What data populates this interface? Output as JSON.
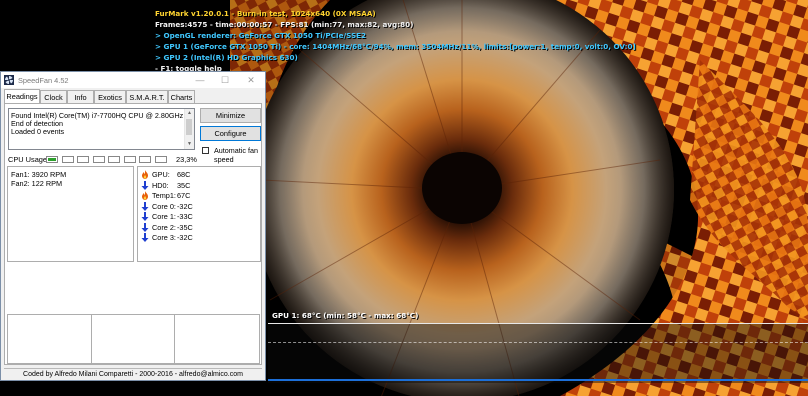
{
  "furmark": {
    "osd": {
      "line1": "FurMark v1.20.0.1 - Burn-in test, 1024x640 (0X MSAA)",
      "line2": "Frames:4575 - time:00:00:57 - FPS:81 (min:77, max:82, avg:80)",
      "line3": "> OpenGL renderer: GeForce GTX 1050 Ti/PCIe/SSE2",
      "line4": "> GPU 1 (GeForce GTX 1050 Ti) - core: 1404MHz/68°C/94%, mem: 3504MHz/11%, limits:[power:1, temp:0, volt:0, OV:0]",
      "line5": "> GPU 2 (Intel(R) HD Graphics 630)",
      "line6": "- F1: toggle help"
    },
    "gpu_graph_label": "GPU 1: 68°C (min: 58°C - max: 68°C)",
    "colors": {
      "osd_yellow": "#ffd430",
      "osd_cyan": "#40c8ff",
      "graph_line": "#1c6fd8"
    }
  },
  "speedfan": {
    "title": "SpeedFan 4.52",
    "window_buttons": {
      "minimize": "—",
      "maximize": "☐",
      "close": "✕"
    },
    "tabs": [
      {
        "label": "Readings"
      },
      {
        "label": "Clock"
      },
      {
        "label": "Info"
      },
      {
        "label": "Exotics"
      },
      {
        "label": "S.M.A.R.T."
      },
      {
        "label": "Charts"
      }
    ],
    "log_lines": [
      "Found Intel(R) Core(TM) i7-7700HQ CPU @ 2.80GHz",
      "End of detection",
      "Loaded 0 events"
    ],
    "buttons": {
      "minimize": "Minimize",
      "configure": "Configure"
    },
    "auto_fan_label": "Automatic fan speed",
    "auto_fan_checked": false,
    "cpu_usage_label": "CPU Usage",
    "cpu_usage_value": "23,3%",
    "cpu_core_usage_fraction": [
      0.85,
      0.0,
      0.0,
      0.0,
      0.0,
      0.0,
      0.0,
      0.0
    ],
    "fans": [
      {
        "label": "Fan1: 3920 RPM"
      },
      {
        "label": "Fan2: 122 RPM"
      }
    ],
    "temps": [
      {
        "name": "GPU:",
        "value": "68C",
        "icon": "flame-icon"
      },
      {
        "name": "HD0:",
        "value": "35C",
        "icon": "down-arrow-icon"
      },
      {
        "name": "Temp1:",
        "value": "67C",
        "icon": "flame-icon"
      },
      {
        "name": "Core 0:",
        "value": "-32C",
        "icon": "down-arrow-icon"
      },
      {
        "name": "Core 1:",
        "value": "-33C",
        "icon": "down-arrow-icon"
      },
      {
        "name": "Core 2:",
        "value": "-35C",
        "icon": "down-arrow-icon"
      },
      {
        "name": "Core 3:",
        "value": "-32C",
        "icon": "down-arrow-icon"
      }
    ],
    "status_text": "Coded by Alfredo Milani Comparetti - 2000-2016 - alfredo@almico.com",
    "colors": {
      "usage_green": "#2ca02c",
      "hot_icon": "#e8600a",
      "cool_icon": "#1f3fd0"
    }
  }
}
